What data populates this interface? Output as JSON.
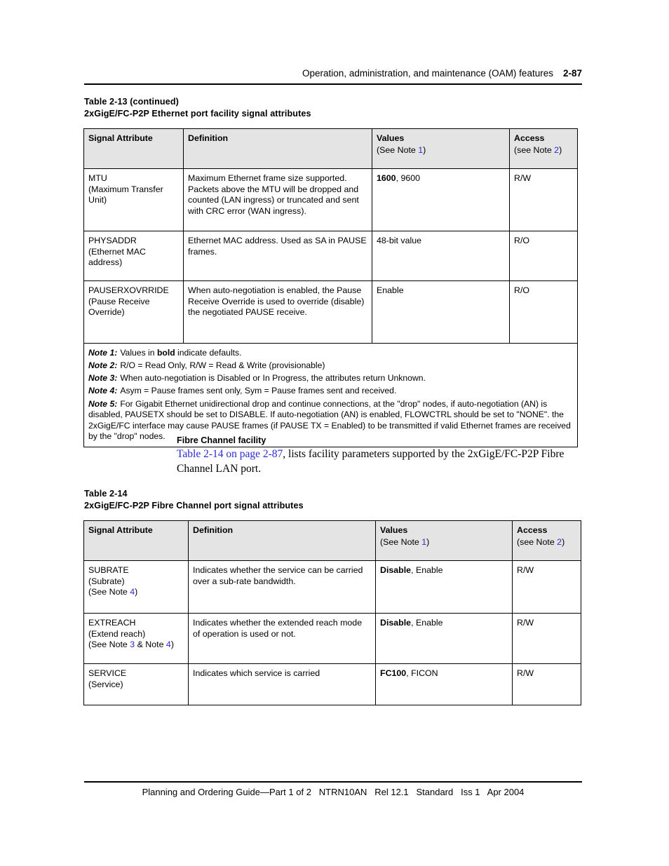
{
  "header": {
    "title": "Operation, administration, and maintenance (OAM) features",
    "page_number": "2-87"
  },
  "table1": {
    "caption_line1": "Table 2-13 (continued)",
    "caption_line2": "2xGigE/FC-P2P Ethernet port facility signal attributes",
    "columns": [
      {
        "label": "Signal Attribute",
        "sub": ""
      },
      {
        "label": "Definition",
        "sub": ""
      },
      {
        "label": "Values",
        "sub_pre": "(See Note ",
        "sub_note": "1",
        "sub_post": ")"
      },
      {
        "label": "Access",
        "sub_pre": "(see Note ",
        "sub_note": "2",
        "sub_post": ")"
      }
    ],
    "rows": [
      {
        "attribute_name": "MTU",
        "attribute_desc1": "(Maximum Transfer",
        "attribute_desc2": "Unit)",
        "definition": "Maximum Ethernet frame size supported. Packets above the MTU will be dropped and counted (LAN ingress) or truncated and sent with CRC error (WAN ingress).",
        "value_bold": "1600",
        "value_rest": ", 9600",
        "access": "R/W"
      },
      {
        "attribute_name": "PHYSADDR",
        "attribute_desc1": "(Ethernet MAC",
        "attribute_desc2": "address)",
        "definition": "Ethernet MAC address. Used as SA in PAUSE frames.",
        "value_bold": "",
        "value_rest": "48-bit value",
        "access": "R/O"
      },
      {
        "attribute_name": "PAUSERXOVRRIDE",
        "attribute_desc1": "(Pause Receive",
        "attribute_desc2": "Override)",
        "definition": "When auto-negotiation is enabled, the Pause Receive Override is used to override (disable) the negotiated PAUSE receive.",
        "value_bold": "",
        "value_rest": "Enable",
        "access": "R/O"
      }
    ],
    "notes": [
      {
        "label": "Note 1:",
        "text_pre": "Values in ",
        "bold": "bold",
        "text_post": " indicate defaults."
      },
      {
        "label": "Note 2:",
        "text_pre": "R/O = Read Only, R/W = Read & Write (provisionable)",
        "bold": "",
        "text_post": ""
      },
      {
        "label": "Note 3:",
        "text_pre": "When auto-negotiation is Disabled or In Progress, the attributes return Unknown.",
        "bold": "",
        "text_post": ""
      },
      {
        "label": "Note 4:",
        "text_pre": "Asym = Pause frames sent only, Sym = Pause frames sent and received.",
        "bold": "",
        "text_post": ""
      },
      {
        "label": "Note 5:",
        "text_pre": "For Gigabit Ethernet unidirectional drop and continue connections, at the \"drop\" nodes, if auto-negotiation (AN) is disabled, PAUSETX should be set to DISABLE. If auto-negotiation (AN) is enabled, FLOWCTRL should be set to \"NONE\". the 2xGigE/FC interface may cause PAUSE frames (if PAUSE TX = Enabled) to be transmitted if valid Ethernet frames are received by the \"drop\" nodes.",
        "bold": "",
        "text_post": ""
      }
    ]
  },
  "body": {
    "heading": "Fibre Channel facility",
    "xref": "Table 2-14 on page 2-87",
    "paragraph_rest": ", lists facility parameters supported by the 2xGigE/FC-P2P Fibre Channel LAN port."
  },
  "table2": {
    "caption_line1": "Table 2-14",
    "caption_line2": "2xGigE/FC-P2P Fibre Channel port signal attributes",
    "columns": [
      {
        "label": "Signal Attribute",
        "sub": ""
      },
      {
        "label": "Definition",
        "sub": ""
      },
      {
        "label": "Values",
        "sub_pre": "(See Note ",
        "sub_note": "1",
        "sub_post": ")"
      },
      {
        "label": "Access",
        "sub_pre": "(see Note ",
        "sub_note": "2",
        "sub_post": ")"
      }
    ],
    "rows": [
      {
        "attribute_name": "SUBRATE",
        "attribute_desc1": "(Subrate)",
        "note_pre": "(See Note ",
        "note_a": "4",
        "note_mid": "",
        "note_b": "",
        "note_post": ")",
        "definition": "Indicates whether the service can be carried over a sub-rate bandwidth.",
        "value_bold": "Disable",
        "value_rest": ", Enable",
        "access": "R/W"
      },
      {
        "attribute_name": "EXTREACH",
        "attribute_desc1": "(Extend reach)",
        "note_pre": "(See Note ",
        "note_a": "3",
        "note_mid": " & Note ",
        "note_b": "4",
        "note_post": ")",
        "definition": "Indicates whether the extended reach mode of operation is used or not.",
        "value_bold": "Disable",
        "value_rest": ", Enable",
        "access": "R/W"
      },
      {
        "attribute_name": "SERVICE",
        "attribute_desc1": "(Service)",
        "note_pre": "",
        "note_a": "",
        "note_mid": "",
        "note_b": "",
        "note_post": "",
        "definition": "Indicates which service is carried",
        "value_bold": "FC100",
        "value_rest": ", FICON",
        "access": "R/W"
      }
    ]
  },
  "footer": {
    "text": "Planning and Ordering Guide—Part 1 of 2   NTRN10AN   Rel 12.1   Standard   Iss 1   Apr 2004"
  },
  "colors": {
    "link": "#2b2bd4",
    "header_fill": "#e4e4e4",
    "rule": "#000000"
  }
}
